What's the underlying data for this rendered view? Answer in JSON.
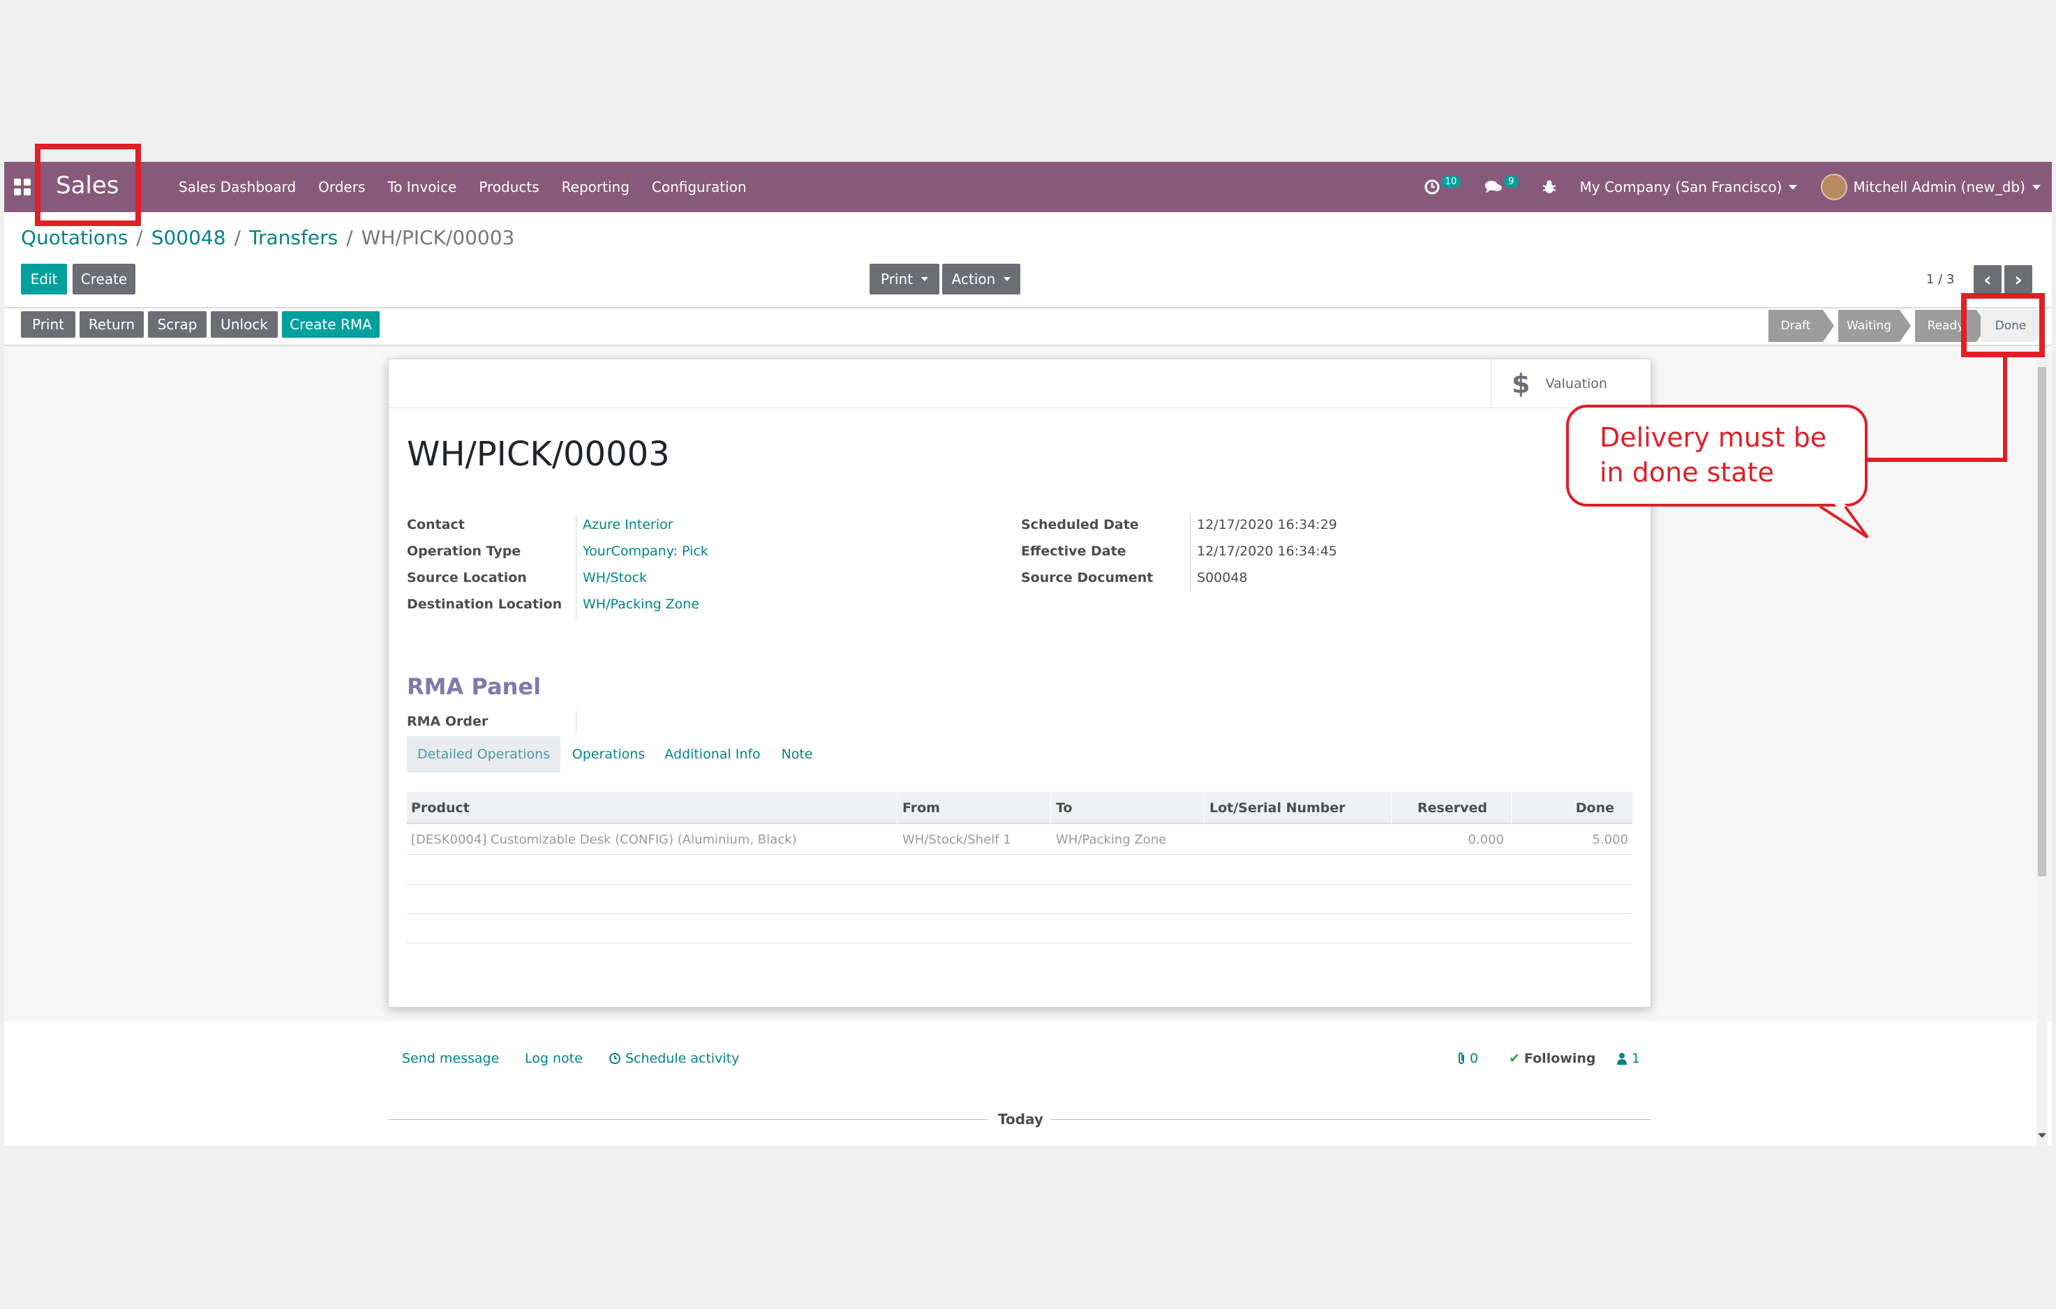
{
  "navbar": {
    "app_name": "Sales",
    "menu": [
      "Sales Dashboard",
      "Orders",
      "To Invoice",
      "Products",
      "Reporting",
      "Configuration"
    ],
    "activity_count": "10",
    "message_count": "9",
    "company": "My Company (San Francisco)",
    "user": "Mitchell Admin (new_db)",
    "accent_color": "#875a7b"
  },
  "breadcrumb": {
    "items": [
      "Quotations",
      "S00048",
      "Transfers"
    ],
    "current": "WH/PICK/00003",
    "separator": "/"
  },
  "control": {
    "edit": "Edit",
    "create": "Create",
    "print": "Print",
    "action": "Action",
    "pager": "1 / 3",
    "prev_icon": "‹",
    "next_icon": "›"
  },
  "header_buttons": [
    "Print",
    "Return",
    "Scrap",
    "Unlock",
    "Create RMA"
  ],
  "statusbar": {
    "states": [
      "Draft",
      "Waiting",
      "Ready",
      "Done"
    ],
    "current": "Done"
  },
  "form": {
    "valuation_icon": "$",
    "valuation_label": "Valuation",
    "title": "WH/PICK/00003",
    "left_fields": [
      {
        "label": "Contact",
        "value": "Azure Interior"
      },
      {
        "label": "Operation Type",
        "value": "YourCompany: Pick"
      },
      {
        "label": "Source Location",
        "value": "WH/Stock"
      },
      {
        "label": "Destination Location",
        "value": "WH/Packing Zone"
      }
    ],
    "right_fields": [
      {
        "label": "Scheduled Date",
        "value": "12/17/2020 16:34:29"
      },
      {
        "label": "Effective Date",
        "value": "12/17/2020 16:34:45"
      },
      {
        "label": "Source Document",
        "value": "S00048"
      }
    ],
    "rma_panel_title": "RMA Panel",
    "rma_order_label": "RMA Order",
    "tabs": [
      "Detailed Operations",
      "Operations",
      "Additional Info",
      "Note"
    ],
    "active_tab": "Detailed Operations",
    "table": {
      "columns": [
        "Product",
        "From",
        "To",
        "Lot/Serial Number",
        "Reserved",
        "Done"
      ],
      "rows": [
        [
          "[DESK0004] Customizable Desk (CONFIG) (Aluminium, Black)",
          "WH/Stock/Shelf 1",
          "WH/Packing Zone",
          "",
          "0.000",
          "5.000"
        ]
      ]
    }
  },
  "chatter": {
    "send_message": "Send message",
    "log_note": "Log note",
    "schedule_activity": "Schedule activity",
    "attachments": "0",
    "following": "Following",
    "followers": "1",
    "today": "Today"
  },
  "annotation": {
    "callout_text": "Delivery must be in done state",
    "highlight_color": "#e21e26"
  }
}
